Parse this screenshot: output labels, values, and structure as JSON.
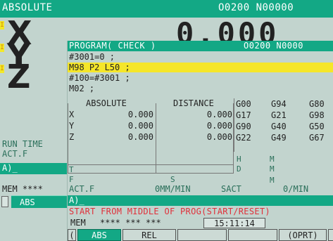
{
  "back_window": {
    "title": "ABSOLUTE",
    "program_no": "O0200 N00000",
    "axes": [
      "X",
      "Y",
      "Z"
    ],
    "axis_marker": "I",
    "big_value": "0.000",
    "labels": {
      "run_time": "RUN TIME",
      "act_f": "ACT.F"
    },
    "input_prompt": "A)_",
    "status_mode": "MEM ****",
    "softkey_abs": "ABS"
  },
  "front_window": {
    "title": "PROGRAM( CHECK )",
    "program_no": "O0200 N0000",
    "program_lines": [
      {
        "text": "#3001=0 ;",
        "highlight": false
      },
      {
        "text": "M98 P2 L50 ;",
        "highlight": true
      },
      {
        "text": "#100=#3001 ;",
        "highlight": false
      },
      {
        "text": "M02 ;",
        "highlight": false
      }
    ],
    "coord_headers": {
      "absolute": "ABSOLUTE",
      "distance": "DISTANCE"
    },
    "coords": [
      {
        "axis": "X",
        "absolute": "0.000",
        "distance": "0.000"
      },
      {
        "axis": "Y",
        "absolute": "0.000",
        "distance": "0.000"
      },
      {
        "axis": "Z",
        "absolute": "0.000",
        "distance": "0.000"
      }
    ],
    "gcodes": [
      [
        "G00",
        "G94",
        "G80"
      ],
      [
        "G17",
        "G21",
        "G98"
      ],
      [
        "G90",
        "G40",
        "G50"
      ],
      [
        "G22",
        "G49",
        "G67"
      ]
    ],
    "hm_labels": {
      "h": "H",
      "m1": "M",
      "d": "D",
      "m2": "M",
      "m3": "M"
    },
    "tfs_labels": {
      "t": "T",
      "f": "F",
      "s": "S"
    },
    "act_f": {
      "label": "ACT.F",
      "value": "0MM/MIN",
      "sact_label": "SACT",
      "sact_value": "0/MIN"
    },
    "input_prompt": "A)_",
    "message": "START FROM MIDDLE OF PROG(START/RESET)",
    "status": {
      "mode": "MEM",
      "stars": "**** *** ***",
      "time": "15:11:14"
    },
    "softkeys": {
      "prev": "(",
      "abs": "ABS",
      "rel": "REL",
      "oprt": "(OPRT)"
    }
  }
}
